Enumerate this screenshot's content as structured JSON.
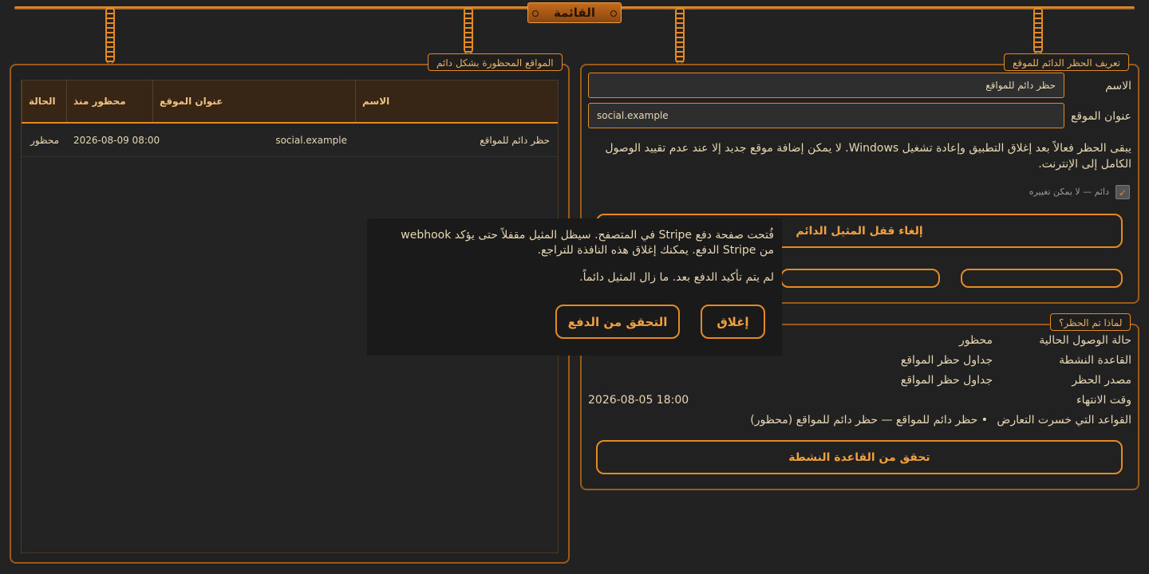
{
  "menu": {
    "label": "القائمة"
  },
  "left_panel": {
    "title": "المواقع المحظورة بشكل دائم",
    "columns": [
      "الاسم",
      "عنوان الموقع",
      "محظور منذ",
      "الحالة"
    ],
    "rows": [
      {
        "name": "حظر دائم للمواقع",
        "address": "social.example",
        "since": "2026-08-09 08:00",
        "status": "محظور"
      }
    ]
  },
  "right_panel": {
    "title": "تعريف الحظر الدائم للموقع",
    "name_label": "الاسم",
    "name_value": "حظر دائم للمواقع",
    "address_label": "عنوان الموقع",
    "address_value": "social.example",
    "description": "يبقى الحظر فعالاً بعد إغلاق التطبيق وإعادة تشغيل Windows. لا يمكن إضافة موقع جديد إلا عند عدم تقييد الوصول الكامل إلى الإنترنت.",
    "permanent_checkbox_label": "دائم — لا يمكن تغييره",
    "permanent_checked": true,
    "unlock_button": "إلغاء قفل المثيل الدائم",
    "button_a": "",
    "button_b": ""
  },
  "why_panel": {
    "title": "لماذا تم الحظر؟",
    "rows": [
      {
        "label": "حالة الوصول الحالية",
        "value": "محظور"
      },
      {
        "label": "القاعدة النشطة",
        "value": "جداول حظر المواقع"
      },
      {
        "label": "مصدر الحظر",
        "value": "جداول حظر المواقع"
      },
      {
        "label": "وقت الانتهاء",
        "value": "2026-08-05 18:00"
      }
    ],
    "lost_rules_label": "القواعد التي خسرت التعارض",
    "lost_rules_value": "• حظر دائم للمواقع — حظر دائم للمواقع (محظور)",
    "verify_button": "تحقق من القاعدة النشطة"
  },
  "dialog": {
    "message": "فُتحت صفحة دفع Stripe في المتصفح. سيظل المثيل مقفلاً حتى يؤكد webhook من Stripe الدفع. يمكنك إغلاق هذه النافذة للتراجع.",
    "status": "لم يتم تأكيد الدفع بعد. ما زال المثيل دائماً.",
    "close_button": "إغلاق",
    "verify_button": "التحقق من الدفع"
  },
  "colors": {
    "accent": "#e58a22",
    "background": "#222222",
    "header": "#372616"
  }
}
